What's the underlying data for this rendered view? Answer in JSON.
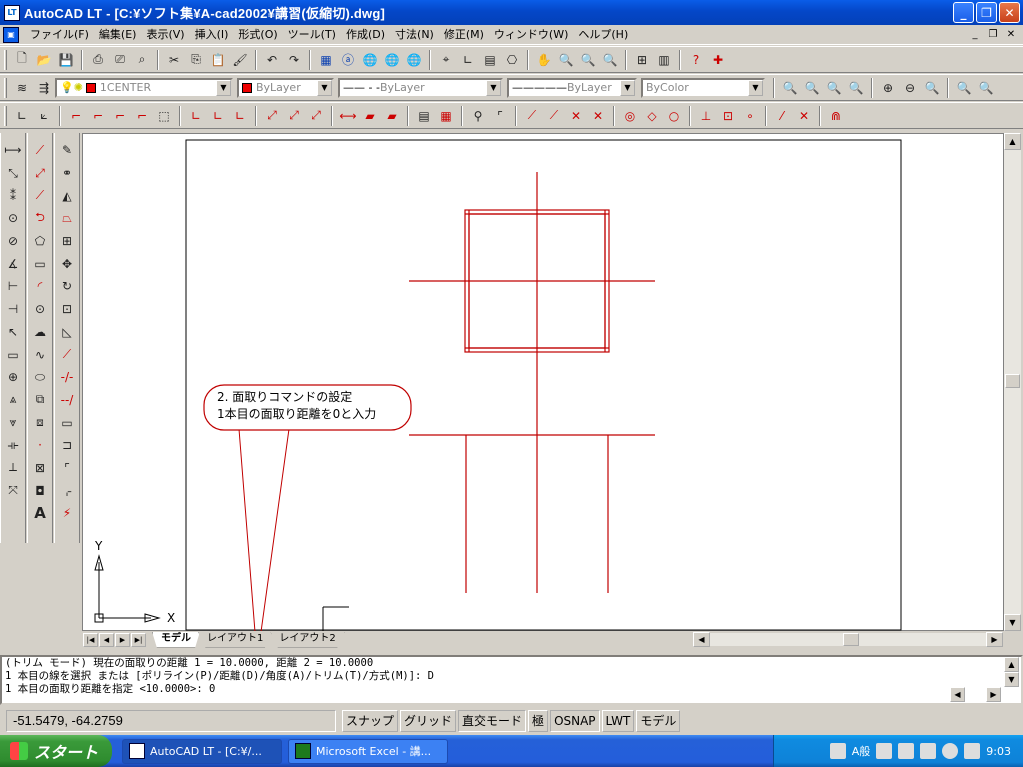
{
  "window": {
    "title": "AutoCAD LT - [C:¥ソフト集¥A-cad2002¥講習(仮縮切).dwg]",
    "app_icon": "LT"
  },
  "menu": {
    "items": [
      "ファイル(F)",
      "編集(E)",
      "表示(V)",
      "挿入(I)",
      "形式(O)",
      "ツール(T)",
      "作成(D)",
      "寸法(N)",
      "修正(M)",
      "ウィンドウ(W)",
      "ヘルプ(H)"
    ]
  },
  "properties": {
    "layer": "1CENTER",
    "color": "ByLayer",
    "linetype": "ByLayer",
    "lineweight": "ByLayer",
    "plotstyle": "ByColor"
  },
  "annotation": {
    "line1": "2. 面取りコマンドの設定",
    "line2": "1本目の面取り距離を0と入力",
    "color": "#c00000"
  },
  "ucs": {
    "x": "X",
    "y": "Y"
  },
  "layout_tabs": {
    "model": "モデル",
    "layout1": "レイアウト1",
    "layout2": "レイアウト2"
  },
  "command": {
    "lines": [
      "(トリム モード) 現在の面取りの距離 1 = 10.0000, 距離 2 = 10.0000",
      "1 本目の線を選択 または [ポリライン(P)/距離(D)/角度(A)/トリム(T)/方式(M)]: D",
      "1 本目の面取り距離を指定 <10.0000>: 0"
    ]
  },
  "status": {
    "coords": "-51.5479,   -64.2759",
    "buttons": [
      "スナップ",
      "グリッド",
      "直交モード",
      "極",
      "OSNAP",
      "LWT",
      "モデル"
    ]
  },
  "taskbar": {
    "start": "スタート",
    "tasks": [
      "AutoCAD LT - [C:¥/...",
      "Microsoft Excel - 講..."
    ],
    "ime": "A般",
    "time": "9:03"
  }
}
